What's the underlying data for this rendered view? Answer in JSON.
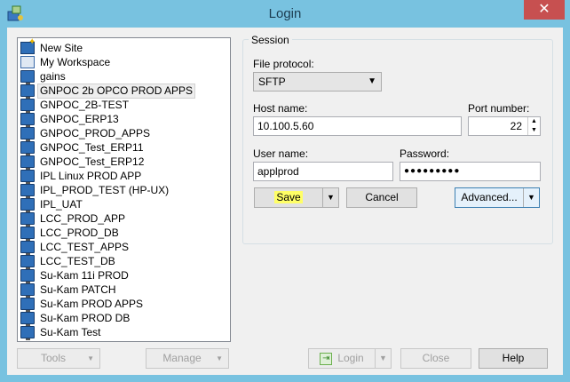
{
  "window": {
    "title": "Login",
    "close_glyph": "✕"
  },
  "sites": [
    {
      "label": "New Site",
      "icon": "new-site-icon"
    },
    {
      "label": "My Workspace",
      "icon": "workspace-icon"
    },
    {
      "label": "gains",
      "icon": "monitor-icon"
    },
    {
      "label": "GNPOC 2b OPCO PROD APPS",
      "icon": "monitor-icon"
    },
    {
      "label": "GNPOC_2B-TEST",
      "icon": "monitor-icon"
    },
    {
      "label": "GNPOC_ERP13",
      "icon": "monitor-icon"
    },
    {
      "label": "GNPOC_PROD_APPS",
      "icon": "monitor-icon"
    },
    {
      "label": "GNPOC_Test_ERP11",
      "icon": "monitor-icon"
    },
    {
      "label": "GNPOC_Test_ERP12",
      "icon": "monitor-icon"
    },
    {
      "label": "IPL Linux PROD APP",
      "icon": "monitor-icon"
    },
    {
      "label": "IPL_PROD_TEST (HP-UX)",
      "icon": "monitor-icon"
    },
    {
      "label": "IPL_UAT",
      "icon": "monitor-icon"
    },
    {
      "label": "LCC_PROD_APP",
      "icon": "monitor-icon"
    },
    {
      "label": "LCC_PROD_DB",
      "icon": "monitor-icon"
    },
    {
      "label": "LCC_TEST_APPS",
      "icon": "monitor-icon"
    },
    {
      "label": "LCC_TEST_DB",
      "icon": "monitor-icon"
    },
    {
      "label": "Su-Kam 11i PROD",
      "icon": "monitor-icon"
    },
    {
      "label": "Su-Kam PATCH",
      "icon": "monitor-icon"
    },
    {
      "label": "Su-Kam PROD APPS",
      "icon": "monitor-icon"
    },
    {
      "label": "Su-Kam PROD DB",
      "icon": "monitor-icon"
    },
    {
      "label": "Su-Kam Test",
      "icon": "monitor-icon"
    }
  ],
  "selected_site": "GNPOC 2b OPCO PROD APPS",
  "session": {
    "legend": "Session",
    "file_protocol_label": "File protocol:",
    "file_protocol_value": "SFTP",
    "host_label": "Host name:",
    "host_value": "10.100.5.60",
    "port_label": "Port number:",
    "port_value": "22",
    "user_label": "User name:",
    "user_value": "applprod",
    "password_label": "Password:",
    "password_value": "●●●●●●●●●"
  },
  "buttons": {
    "save": "Save",
    "cancel": "Cancel",
    "advanced": "Advanced...",
    "tools": "Tools",
    "manage": "Manage",
    "login": "Login",
    "close": "Close",
    "help": "Help"
  },
  "colors": {
    "save_highlight": "#ffff66",
    "close_button": "#c75050",
    "frame": "#78c2e0"
  }
}
